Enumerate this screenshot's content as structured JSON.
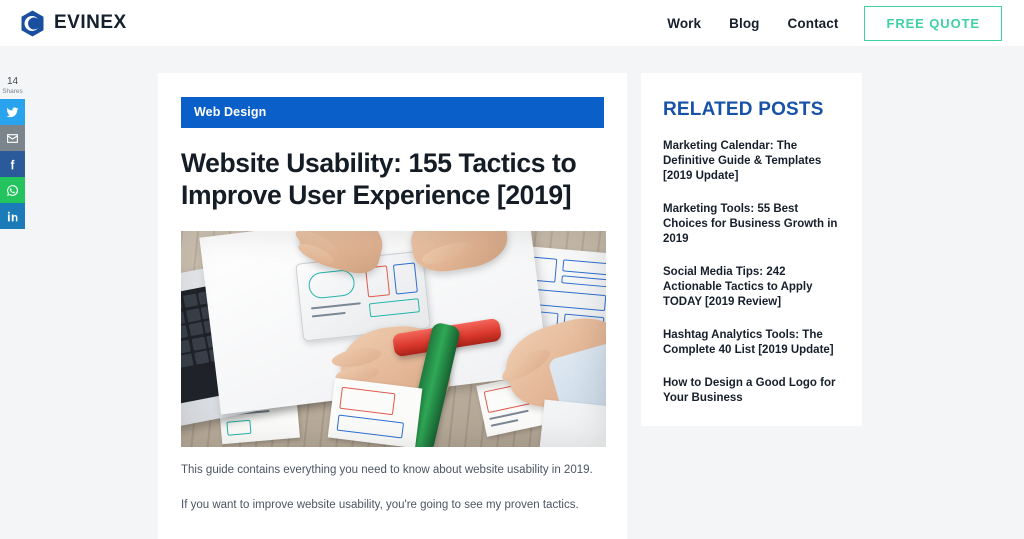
{
  "header": {
    "brand_name": "EVINEX",
    "brand_icon": "hexagon-logo-icon",
    "nav": [
      {
        "label": "Work",
        "name": "work"
      },
      {
        "label": "Blog",
        "name": "blog"
      },
      {
        "label": "Contact",
        "name": "contact"
      }
    ],
    "cta_label": "FREE QUOTE",
    "cta_color": "#3fd1a4"
  },
  "social_rail": {
    "count": "14",
    "count_label": "Shares",
    "buttons": [
      {
        "name": "twitter",
        "icon": "twitter-icon",
        "color": "#2aa3ef"
      },
      {
        "name": "email",
        "icon": "email-icon",
        "color": "#7d858c"
      },
      {
        "name": "facebook",
        "icon": "facebook-icon",
        "color": "#2b5a9b"
      },
      {
        "name": "whatsapp",
        "icon": "whatsapp-icon",
        "color": "#23c45e"
      },
      {
        "name": "linkedin",
        "icon": "linkedin-icon",
        "color": "#1b7bb9"
      }
    ]
  },
  "article": {
    "category": "Web Design",
    "category_color": "#0b5fc9",
    "title": "Website Usability: 155 Tactics to Improve User Experience [2019]",
    "image_alt": "Hands working on paper website wireframe sketches with laptop, tablet and colored markers on a wooden desk",
    "paragraph_1": "This guide contains everything you need to know about website usability in 2019.",
    "paragraph_2": "If you want to improve website usability, you're going to see my proven tactics."
  },
  "related": {
    "heading": "RELATED POSTS",
    "heading_color": "#1752a8",
    "items": [
      {
        "title": "Marketing Calendar: The Definitive Guide & Templates [2019 Update]"
      },
      {
        "title": "Marketing Tools: 55 Best Choices for Business Growth in 2019"
      },
      {
        "title": "Social Media Tips: 242 Actionable Tactics to Apply TODAY [2019 Review]"
      },
      {
        "title": "Hashtag Analytics Tools: The Complete 40 List [2019 Update]"
      },
      {
        "title": "How to Design a Good Logo for Your Business"
      }
    ]
  },
  "theme": {
    "page_background": "#f3f5f7",
    "card_background": "#ffffff",
    "text_dark": "#141c26"
  }
}
